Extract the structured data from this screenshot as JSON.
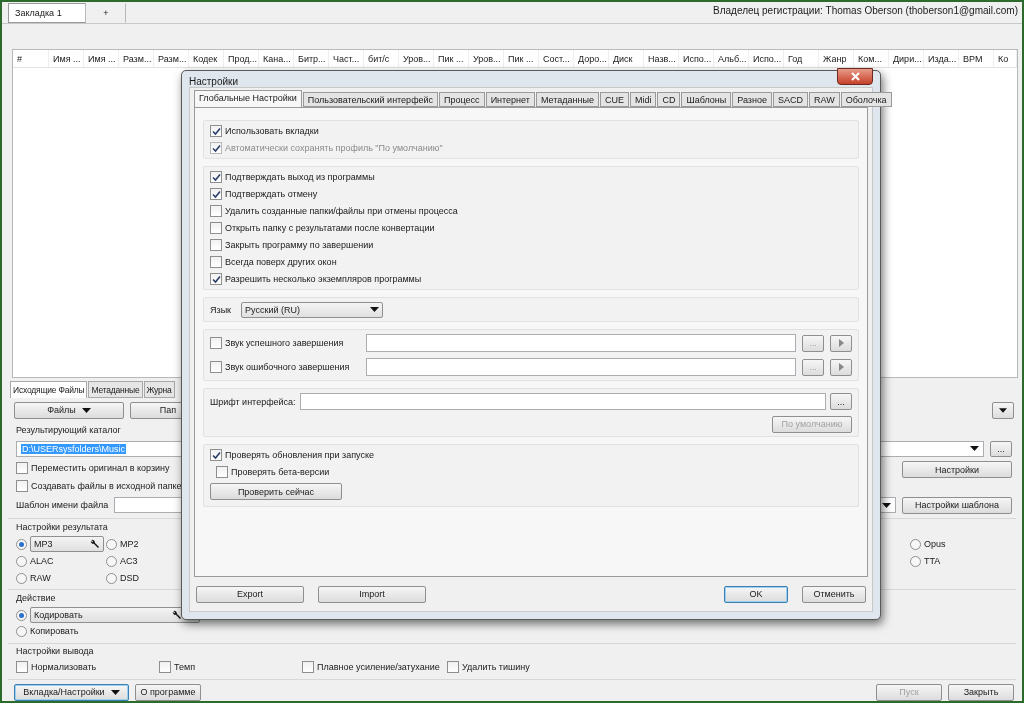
{
  "main_tabs": [
    {
      "label": "Закладка 1",
      "selected": true
    },
    {
      "label": "+",
      "selected": false
    }
  ],
  "owner": "Владелец регистрации: Thomas Oberson (thoberson1@gmail.com)",
  "table": {
    "columns": [
      "#",
      "Имя ...",
      "Имя ...",
      "Разм...",
      "Разм...",
      "Кодек",
      "Прод...",
      "Кана...",
      "Битр...",
      "Част...",
      "бит/с",
      "Уров...",
      "Пик ...",
      "Уров...",
      "Пик ...",
      "Сост...",
      "Доро...",
      "Диск",
      "Назв...",
      "Испо...",
      "Альб...",
      "Испо...",
      "Год",
      "Жанр",
      "Ком...",
      "Дири...",
      "Изда...",
      "BPM",
      "Ко"
    ]
  },
  "bottom_tabs": [
    {
      "label": "Исходящие Файлы",
      "selected": true
    },
    {
      "label": "Метаданные",
      "selected": false
    },
    {
      "label": "Журна",
      "selected": false
    }
  ],
  "source_buttons": {
    "files": "Файлы",
    "folder": "Пап"
  },
  "output": {
    "title": "Результирующий каталог",
    "path": "D:\\USERsysfolders\\Music",
    "browse": "...",
    "checks": [
      {
        "label": "Переместить оригинал в корзину",
        "checked": false
      },
      {
        "label": "Создавать файлы в исходной папке",
        "checked": false
      }
    ],
    "settings_button": "Настройки",
    "template_label": "Шаблон имени файла",
    "template_button": "Настройки шаблона"
  },
  "result_settings": {
    "title": "Настройки результата",
    "columns": [
      {
        "formats": [
          {
            "label": "MP3",
            "selected": true
          },
          {
            "label": "ALAC",
            "selected": false
          },
          {
            "label": "RAW",
            "selected": false
          }
        ]
      },
      {
        "formats": [
          {
            "label": "MP2",
            "selected": false
          },
          {
            "label": "AC3",
            "selected": false
          },
          {
            "label": "DSD",
            "selected": false
          }
        ]
      },
      {
        "formats": [
          {
            "label": "Opus",
            "selected": false
          },
          {
            "label": "TTA",
            "selected": false
          }
        ]
      }
    ]
  },
  "action": {
    "title": "Действие",
    "options": [
      {
        "label": "Кодировать",
        "selected": true
      },
      {
        "label": "Копировать",
        "selected": false
      }
    ]
  },
  "output_settings": {
    "title": "Настройки вывода",
    "options": [
      {
        "label": "Нормализовать",
        "checked": false
      },
      {
        "label": "Темп",
        "checked": false
      },
      {
        "label": "Плавное усиление/затухание",
        "checked": false
      },
      {
        "label": "Удалить тишину",
        "checked": false
      }
    ]
  },
  "footer": {
    "tab_settings": "Вкладка/Настройки",
    "about": "О программе",
    "start": {
      "label": "Пуск",
      "disabled": true
    },
    "close": "Закрыть"
  },
  "dialog": {
    "title": "Настройки",
    "tabs": [
      {
        "label": "Глобальные Настройки",
        "selected": true
      },
      {
        "label": "Пользовательский интерфейс",
        "selected": false
      },
      {
        "label": "Процесс",
        "selected": false
      },
      {
        "label": "Интернет",
        "selected": false
      },
      {
        "label": "Метаданные",
        "selected": false
      },
      {
        "label": "CUE",
        "selected": false
      },
      {
        "label": "Midi",
        "selected": false
      },
      {
        "label": "CD",
        "selected": false
      },
      {
        "label": "Шаблоны",
        "selected": false
      },
      {
        "label": "Разное",
        "selected": false
      },
      {
        "label": "SACD",
        "selected": false
      },
      {
        "label": "RAW",
        "selected": false
      },
      {
        "label": "Оболочка",
        "selected": false
      }
    ],
    "tab_options": [
      {
        "label": "Использовать вкладки",
        "checked": true,
        "disabled": false
      },
      {
        "label": "Автоматически сохранять профиль \"По умолчанию\"",
        "checked": true,
        "disabled": true
      }
    ],
    "general_options": [
      {
        "label": "Подтверждать выход из программы",
        "checked": true,
        "disabled": false
      },
      {
        "label": "Подтверждать отмену",
        "checked": true,
        "disabled": false
      },
      {
        "label": "Удалить созданные папки/файлы при отмены процесса",
        "checked": false,
        "disabled": false
      },
      {
        "label": "Открыть папку с результатами после конвертации",
        "checked": false,
        "disabled": false
      },
      {
        "label": "Закрыть программу по завершении",
        "checked": false,
        "disabled": false
      },
      {
        "label": "Всегда поверх других окон",
        "checked": false,
        "disabled": false
      },
      {
        "label": "Разрешить несколько экземпляров программы",
        "checked": true,
        "disabled": false
      }
    ],
    "language": {
      "label": "Язык",
      "value": "Русский (RU)"
    },
    "sounds": [
      {
        "label": "Звук успешного завершения",
        "checked": false,
        "browse": "..."
      },
      {
        "label": "Звук ошибочного завершения",
        "checked": false,
        "browse": "..."
      }
    ],
    "font": {
      "label": "Шрифт интерфейса:",
      "browse": "...",
      "default_button": "По умолчанию"
    },
    "updates": {
      "check": {
        "label": "Проверять обновления при запуске",
        "checked": true
      },
      "beta": {
        "label": "Проверять бета-версии",
        "checked": false
      },
      "check_now": "Проверить сейчас"
    },
    "buttons": [
      {
        "label": "Export",
        "default": false
      },
      {
        "label": "Import",
        "default": false
      },
      {
        "label": "OK",
        "default": true
      },
      {
        "label": "Отменить",
        "default": false
      }
    ]
  }
}
